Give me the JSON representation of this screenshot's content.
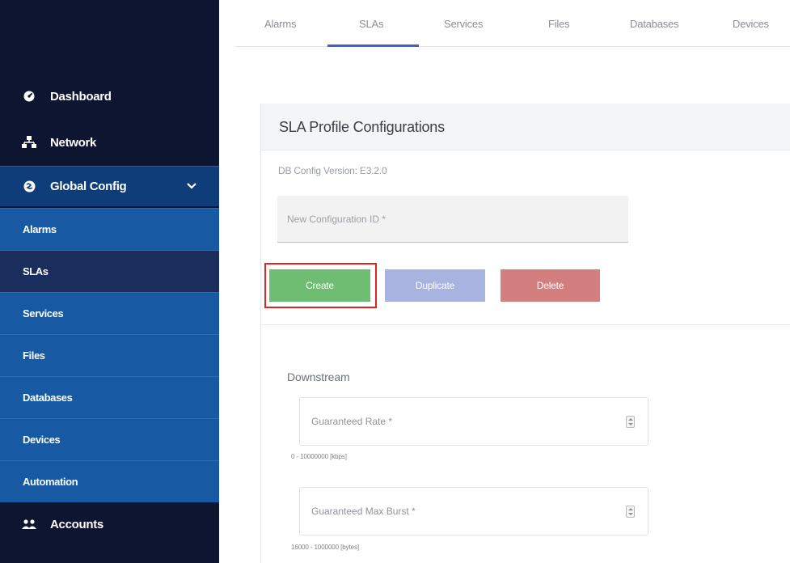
{
  "sidebar": {
    "nav": [
      {
        "label": "Dashboard",
        "icon": "dashboard-icon"
      },
      {
        "label": "Network",
        "icon": "network-icon"
      },
      {
        "label": "Global Config",
        "icon": "globe-icon",
        "expanded": true
      },
      {
        "label": "Accounts",
        "icon": "users-icon"
      }
    ],
    "sub_items": [
      {
        "label": "Alarms"
      },
      {
        "label": "SLAs",
        "active": true
      },
      {
        "label": "Services"
      },
      {
        "label": "Files"
      },
      {
        "label": "Databases"
      },
      {
        "label": "Devices"
      },
      {
        "label": "Automation"
      }
    ]
  },
  "tabs": [
    {
      "label": "Alarms"
    },
    {
      "label": "SLAs",
      "active": true
    },
    {
      "label": "Services"
    },
    {
      "label": "Files"
    },
    {
      "label": "Databases"
    },
    {
      "label": "Devices"
    }
  ],
  "card": {
    "title": "SLA Profile Configurations",
    "db_version": "DB Config Version: E3.2.0",
    "config_id_placeholder": "New Configuration ID *",
    "buttons": {
      "create": "Create",
      "duplicate": "Duplicate",
      "delete": "Delete"
    },
    "section": "Downstream",
    "fields": [
      {
        "placeholder": "Guaranteed Rate *",
        "hint": "0 - 10000000 [kbps]"
      },
      {
        "placeholder": "Guaranteed Max Burst *",
        "hint": "16000 - 1000000 [bytes]"
      }
    ]
  },
  "colors": {
    "sidebar_bg": "#0e1530",
    "submenu_bg": "#175aa3",
    "active_tab": "#3d62c8",
    "create": "#6ebd72",
    "duplicate": "#a8b3e0",
    "delete": "#d37f7f",
    "highlight": "#e02424"
  }
}
